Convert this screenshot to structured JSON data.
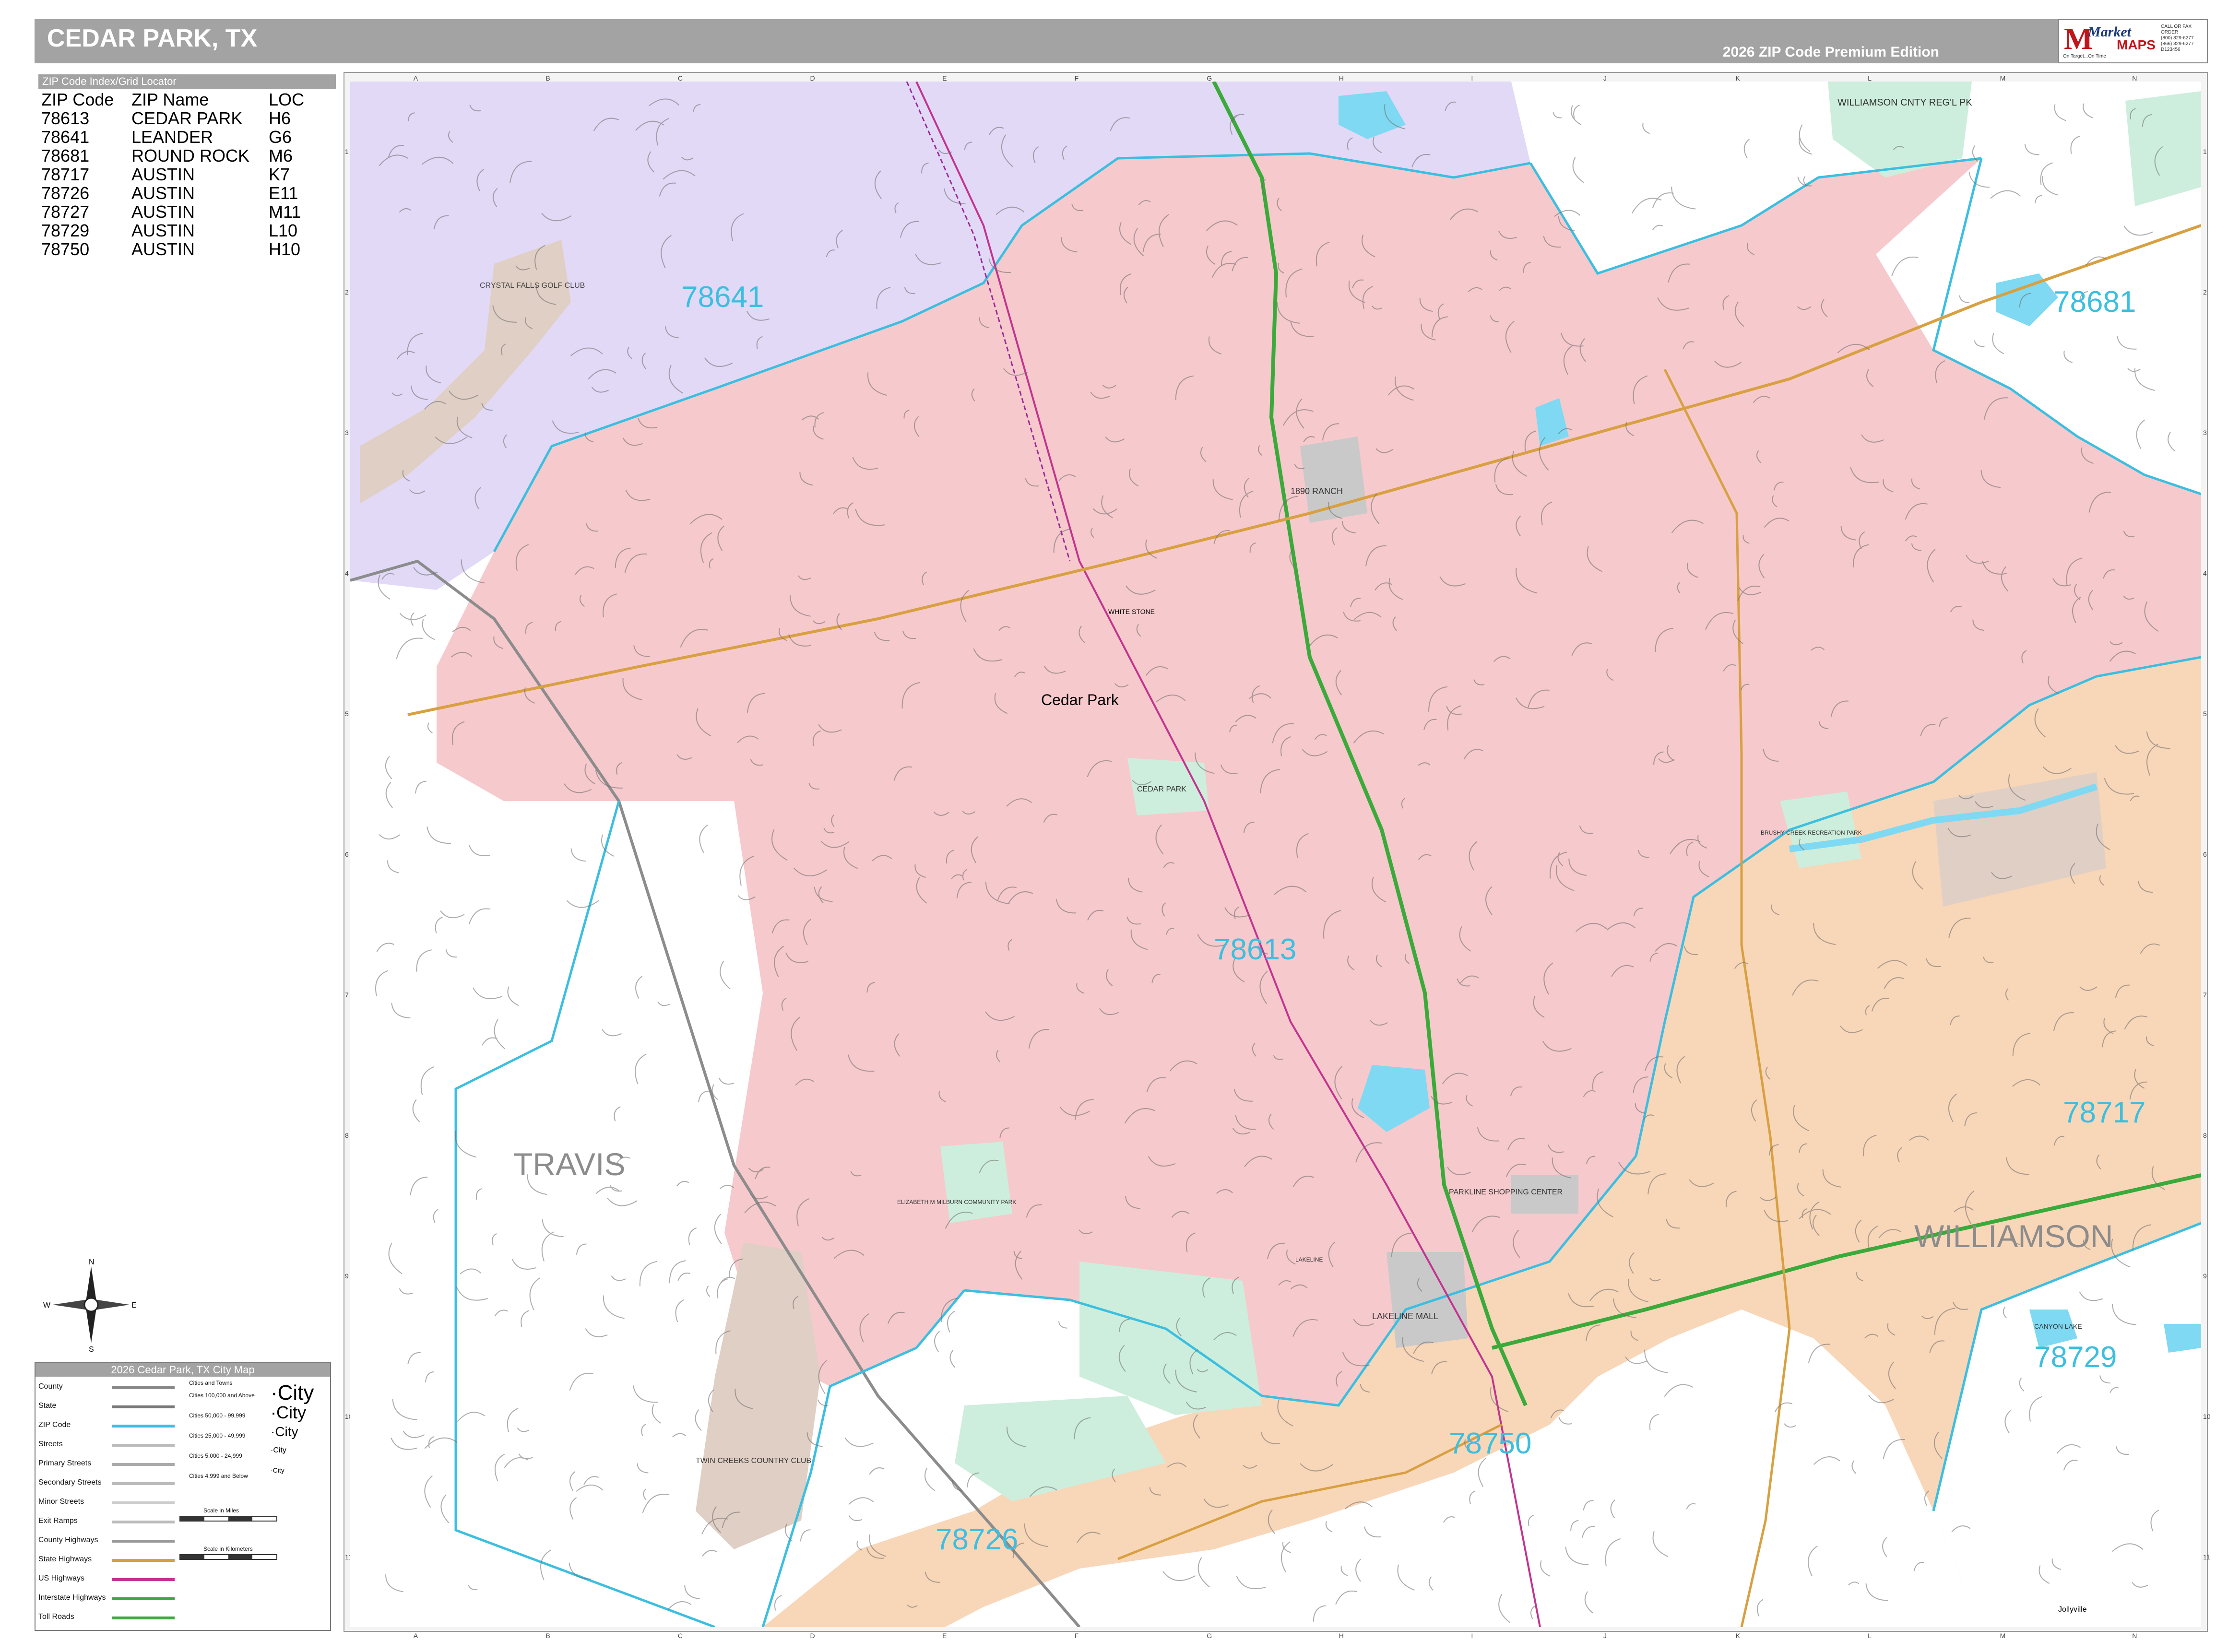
{
  "header": {
    "title": "CEDAR PARK, TX",
    "edition": "2026 ZIP Code Premium Edition"
  },
  "logo": {
    "brand_top": "Market",
    "brand_bottom": "MAPS",
    "tagline": "On Target...On Time",
    "sub": "America's Leading Source of Business Maps",
    "phone_lines": [
      "CALL OR FAX ORDER",
      "(800) 829-6277",
      "(866) 329-6277",
      "D123456"
    ]
  },
  "zip_index": {
    "header": "ZIP Code Index/Grid Locator",
    "columns": [
      "ZIP Code",
      "ZIP Name",
      "LOC"
    ],
    "rows": [
      [
        "78613",
        "CEDAR PARK",
        "H6"
      ],
      [
        "78641",
        "LEANDER",
        "G6"
      ],
      [
        "78681",
        "ROUND ROCK",
        "M6"
      ],
      [
        "78717",
        "AUSTIN",
        "K7"
      ],
      [
        "78726",
        "AUSTIN",
        "E11"
      ],
      [
        "78727",
        "AUSTIN",
        "M11"
      ],
      [
        "78729",
        "AUSTIN",
        "L10"
      ],
      [
        "78750",
        "AUSTIN",
        "H10"
      ]
    ]
  },
  "grid": {
    "columns": [
      "A",
      "B",
      "C",
      "D",
      "E",
      "F",
      "G",
      "H",
      "I",
      "J",
      "K",
      "L",
      "M",
      "N"
    ],
    "rows": [
      "1",
      "2",
      "3",
      "4",
      "5",
      "6",
      "7",
      "8",
      "9",
      "10",
      "11"
    ]
  },
  "map_labels": {
    "zips": [
      "78641",
      "78681",
      "78613",
      "78717",
      "78729",
      "78750",
      "78726"
    ],
    "counties": [
      "TRAVIS",
      "WILLIAMSON"
    ],
    "city": "Cedar Park",
    "places": [
      "CRYSTAL FALLS GOLF CLUB",
      "WILLIAMSON CNTY REG'L PK",
      "1890 RANCH",
      "CEDAR PARK",
      "BRUSHY CREEK RECREATION PARK",
      "PARKLINE SHOPPING CENTER",
      "LAKELINE MALL",
      "ELIZABETH M MILBURN COMMUNITY PARK",
      "TWIN CREEKS COUNTRY CLUB",
      "WHITE STONE",
      "LAKELINE",
      "Jollyville"
    ],
    "lakes": [
      "CANYON LAKE"
    ]
  },
  "compass": {
    "n": "N",
    "s": "S",
    "e": "E",
    "w": "W"
  },
  "legend": {
    "title": "2026 Cedar Park, TX City Map",
    "items": [
      "County",
      "State",
      "ZIP Code",
      "Streets",
      "Primary Streets",
      "Secondary Streets",
      "Minor Streets",
      "Exit Ramps",
      "County Highways",
      "State Highways",
      "US Highways",
      "Interstate Highways",
      "Toll Roads"
    ],
    "cities_title": "Cities and Towns",
    "city_sizes": [
      "Cities 100,000 and Above",
      "Cities 50,000 - 99,999",
      "Cities 25,000 - 49,999",
      "Cities 5,000 - 24,999",
      "Cities 4,999 and Below"
    ],
    "city_sample": "City",
    "scale_miles": "Scale in Miles",
    "scale_km": "Scale in Kilometers"
  },
  "colors": {
    "cedar_park": "#f6c9cc",
    "leander": "#e2d9f7",
    "austin": "#f8d6b8",
    "park": "#cdeedc",
    "golf": "#e0cfc4",
    "water": "#7fd9f2",
    "zip_line": "#3bbfe0",
    "interstate": "#3aaa3a",
    "highway": "#d8a040"
  }
}
